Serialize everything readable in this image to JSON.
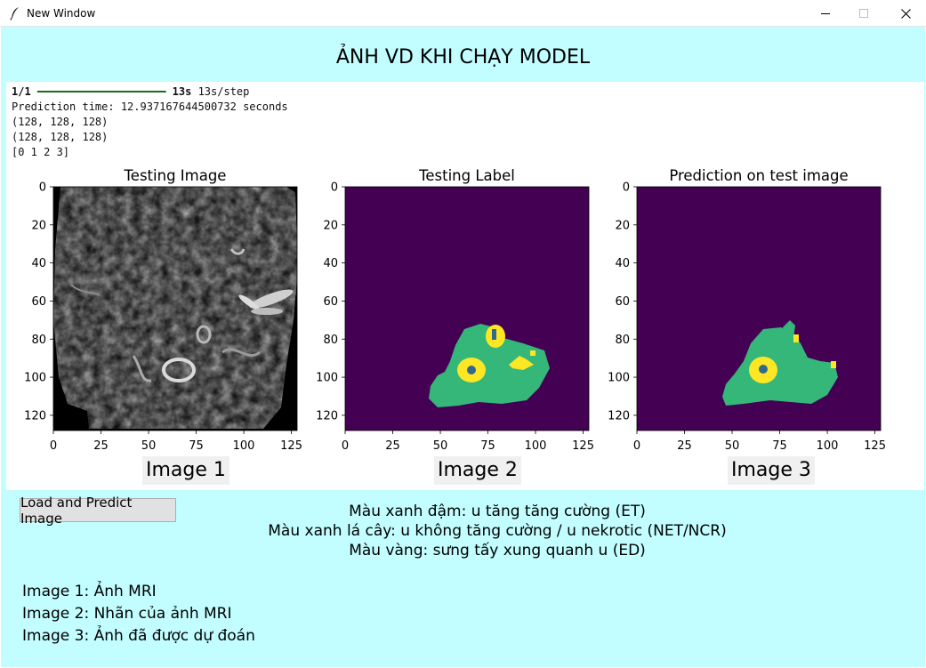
{
  "window": {
    "title": "New Window",
    "controls": {
      "minimize": "minimize-icon",
      "maximize": "maximize-icon",
      "close": "close-icon"
    }
  },
  "heading": "ẢNH VD KHI CHẠY MODEL",
  "console": {
    "progress_prefix": "1/1",
    "progress_time": "13s",
    "progress_rate": "13s/step",
    "lines": [
      "Prediction time: 12.937167644500732 seconds",
      "(128, 128, 128)",
      "(128, 128, 128)",
      "[0 1 2 3]"
    ]
  },
  "chart_data": [
    {
      "type": "heatmap",
      "title": "Testing Image",
      "colormap": "gray",
      "xlim": [
        0,
        128
      ],
      "ylim": [
        128,
        0
      ],
      "xticks": [
        0,
        25,
        50,
        75,
        100,
        125
      ],
      "yticks": [
        0,
        20,
        40,
        60,
        80,
        100,
        120
      ],
      "caption": "Image 1"
    },
    {
      "type": "heatmap",
      "title": "Testing Label",
      "colormap": "viridis",
      "classes": [
        0,
        1,
        2,
        3
      ],
      "class_colors": {
        "0": "#440154",
        "1": "#31688e",
        "2": "#35b779",
        "3": "#fde725"
      },
      "xlim": [
        0,
        128
      ],
      "ylim": [
        128,
        0
      ],
      "xticks": [
        0,
        25,
        50,
        75,
        100,
        125
      ],
      "yticks": [
        0,
        20,
        40,
        60,
        80,
        100,
        120
      ],
      "caption": "Image 2"
    },
    {
      "type": "heatmap",
      "title": "Prediction on test image",
      "colormap": "viridis",
      "classes": [
        0,
        1,
        2,
        3
      ],
      "class_colors": {
        "0": "#440154",
        "1": "#31688e",
        "2": "#35b779",
        "3": "#fde725"
      },
      "xlim": [
        0,
        128
      ],
      "ylim": [
        128,
        0
      ],
      "xticks": [
        0,
        25,
        50,
        75,
        100,
        125
      ],
      "yticks": [
        0,
        20,
        40,
        60,
        80,
        100,
        120
      ],
      "caption": "Image 3"
    }
  ],
  "load_button": "Load and Predict Image",
  "legend": [
    "Màu xanh đậm: u tăng tăng cường (ET)",
    "Màu xanh lá cây: u không tăng cường / u nekrotic (NET/NCR)",
    "Màu vàng: sưng tấy xung quanh u (ED)"
  ],
  "image_notes": [
    "Image 1: Ảnh MRI",
    "Image 2: Nhãn của ảnh MRI",
    "Image 3: Ảnh đã được dự đoán"
  ],
  "colors": {
    "window_background": "#c2fdff",
    "panel_background": "#ffffff",
    "caption_background": "#f0f0f0",
    "button_background": "#e1e1e1",
    "progress_bar": "#1c6a1c"
  }
}
